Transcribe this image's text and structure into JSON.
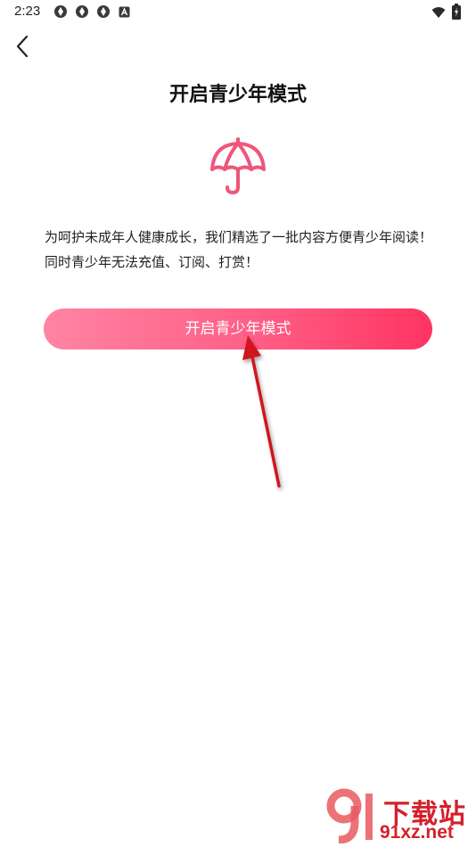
{
  "status_bar": {
    "time": "2:23",
    "icons": [
      "app-notification-icon",
      "app-notification-icon",
      "app-notification-icon",
      "a-notification-icon",
      "wifi-icon",
      "battery-icon"
    ]
  },
  "header": {
    "back_icon": "chevron-left-icon",
    "title": "开启青少年模式"
  },
  "main": {
    "icon": "umbrella-icon",
    "icon_color": "#f0557a",
    "description": "为呵护未成年人健康成长，我们精选了一批内容方便青少年阅读！同时青少年无法充值、订阅、打赏！",
    "button_label": "开启青少年模式",
    "button_gradient": [
      "#ff84a2",
      "#ff3461"
    ]
  },
  "annotation": {
    "arrow_color": "#d0161e"
  },
  "watermark": {
    "title": "下载站",
    "url": "91xz.net",
    "color": "#d4202a"
  }
}
